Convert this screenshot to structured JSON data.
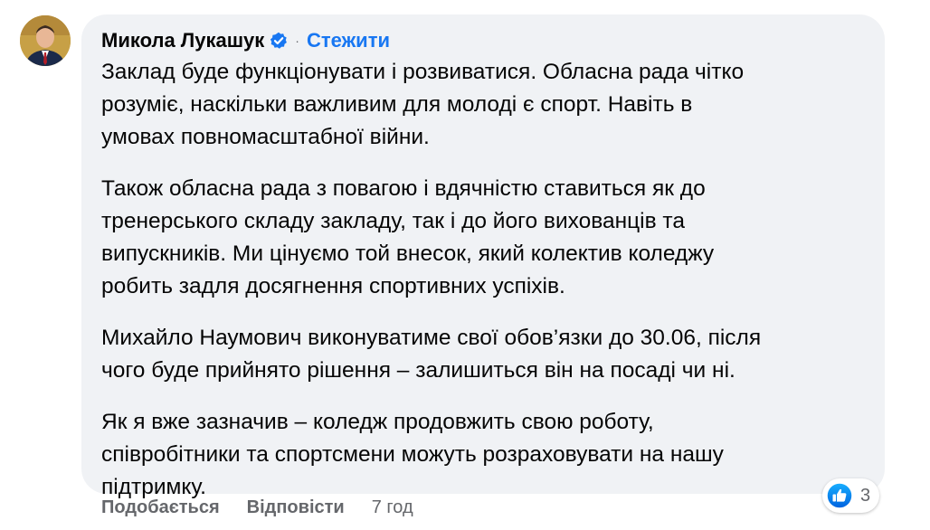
{
  "comment": {
    "author": "Микола Лукашук",
    "separator": "·",
    "follow_label": "Стежити",
    "paragraphs": [
      {
        "lines": [
          "Заклад буде функціонувати і розвиватися. Обласна рада чітко",
          "розуміє, наскільки важливим для молоді є спорт. Навіть в",
          "умовах повномасштабної війни."
        ]
      },
      {
        "lines": [
          "Також обласна рада з повагою і вдячністю ставиться як до",
          "тренерського складу закладу, так і до його вихованців та",
          "випускників. Ми цінуємо той внесок, який колектив коледжу",
          "робить задля досягнення спортивних успіхів."
        ]
      },
      {
        "lines": [
          "Михайло Наумович виконуватиме свої обов’язки до 30.06, після",
          "чого буде прийнято рішення – залишиться він на посаді чи ні."
        ]
      },
      {
        "lines": [
          "Як я вже зазначив – коледж продовжить свою роботу,",
          "співробітники та спортсмени можуть розраховувати на нашу",
          "підтримку."
        ]
      }
    ]
  },
  "actions": {
    "like_label": "Подобається",
    "reply_label": "Відповісти",
    "time": "7 год"
  },
  "reactions": {
    "icon": "like-reaction-icon",
    "count": "3"
  },
  "colors": {
    "link_blue": "#1877f2",
    "bubble_bg": "#f0f2f5",
    "muted_text": "#65676b"
  }
}
